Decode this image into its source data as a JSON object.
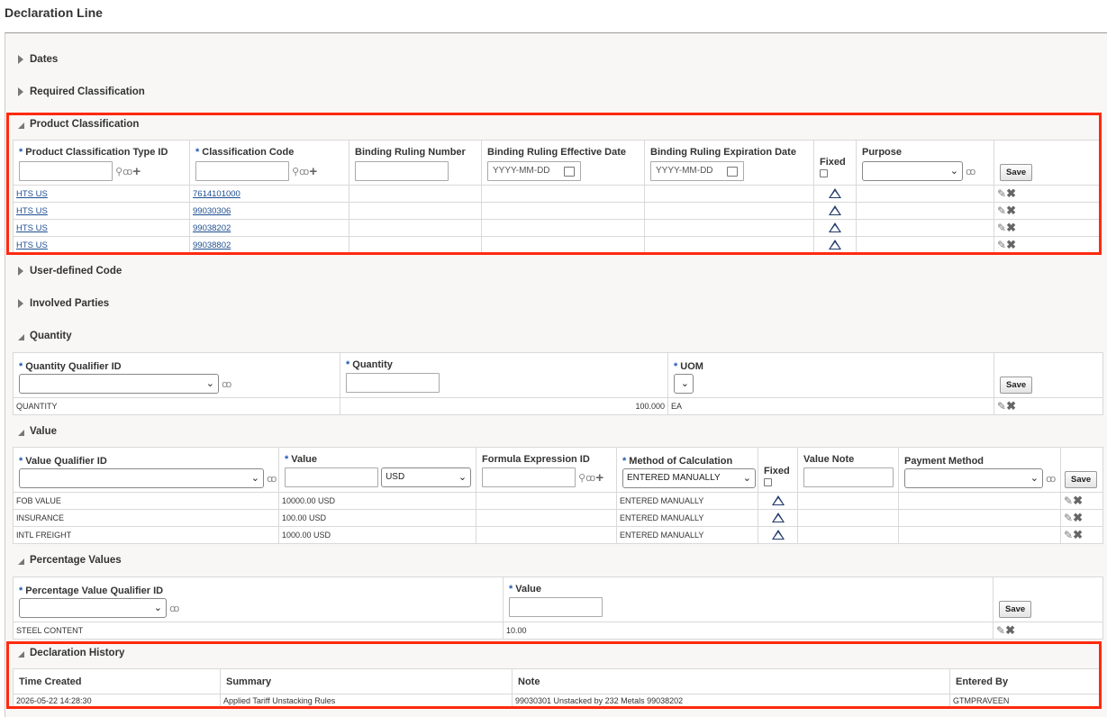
{
  "page_title": "Declaration Line",
  "sections": {
    "dates": "Dates",
    "required_classification": "Required Classification",
    "product_classification": "Product Classification",
    "user_defined_code": "User-defined Code",
    "involved_parties": "Involved Parties",
    "quantity": "Quantity",
    "value": "Value",
    "percentage_values": "Percentage Values",
    "declaration_history": "Declaration History"
  },
  "product_classification": {
    "headers": {
      "type_id": "Product Classification Type ID",
      "code": "Classification Code",
      "binding_number": "Binding Ruling Number",
      "binding_effective": "Binding Ruling Effective Date",
      "binding_expiration": "Binding Ruling Expiration Date",
      "fixed": "Fixed",
      "purpose": "Purpose"
    },
    "date_placeholder": "YYYY-MM-DD",
    "save_label": "Save",
    "rows": [
      {
        "type": "HTS US",
        "code": "7614101000"
      },
      {
        "type": "HTS US",
        "code": "99030306"
      },
      {
        "type": "HTS US",
        "code": "99038202"
      },
      {
        "type": "HTS US",
        "code": "99038802"
      }
    ]
  },
  "quantity": {
    "headers": {
      "qualifier": "Quantity Qualifier ID",
      "quantity": "Quantity",
      "uom": "UOM"
    },
    "save_label": "Save",
    "rows": [
      {
        "qualifier": "QUANTITY",
        "quantity": "100.000",
        "uom": "EA"
      }
    ]
  },
  "value": {
    "headers": {
      "qualifier": "Value Qualifier ID",
      "value": "Value",
      "formula": "Formula Expression ID",
      "method": "Method of Calculation",
      "fixed": "Fixed",
      "note": "Value Note",
      "payment": "Payment Method"
    },
    "currency": "USD",
    "method_selected": "ENTERED MANUALLY",
    "save_label": "Save",
    "rows": [
      {
        "qualifier": "FOB VALUE",
        "value": "10000.00 USD",
        "method": "ENTERED MANUALLY"
      },
      {
        "qualifier": "INSURANCE",
        "value": "100.00 USD",
        "method": "ENTERED MANUALLY"
      },
      {
        "qualifier": "INTL FREIGHT",
        "value": "1000.00 USD",
        "method": "ENTERED MANUALLY"
      }
    ]
  },
  "percentage_values": {
    "headers": {
      "qualifier": "Percentage Value Qualifier ID",
      "value": "Value"
    },
    "save_label": "Save",
    "rows": [
      {
        "qualifier": "STEEL CONTENT",
        "value": "10.00"
      }
    ]
  },
  "declaration_history": {
    "headers": {
      "time": "Time Created",
      "summary": "Summary",
      "note": "Note",
      "entered_by": "Entered By"
    },
    "rows": [
      {
        "time": "2026-05-22 14:28:30",
        "summary": "Applied Tariff Unstacking Rules",
        "note": "99030301 Unstacked by 232 Metals 99038202",
        "entered_by": "GTMPRAVEEN"
      }
    ]
  },
  "colors": {
    "highlight": "#ff2a0e",
    "required_star": "#1f57b3",
    "link": "#1e4e8f"
  },
  "icons": [
    "search-icon",
    "glasses-icon",
    "plus-icon",
    "calendar-icon",
    "chevron-down-icon",
    "triangle-fixed-icon",
    "pencil-icon",
    "delete-icon",
    "expand-icon",
    "collapse-icon"
  ]
}
